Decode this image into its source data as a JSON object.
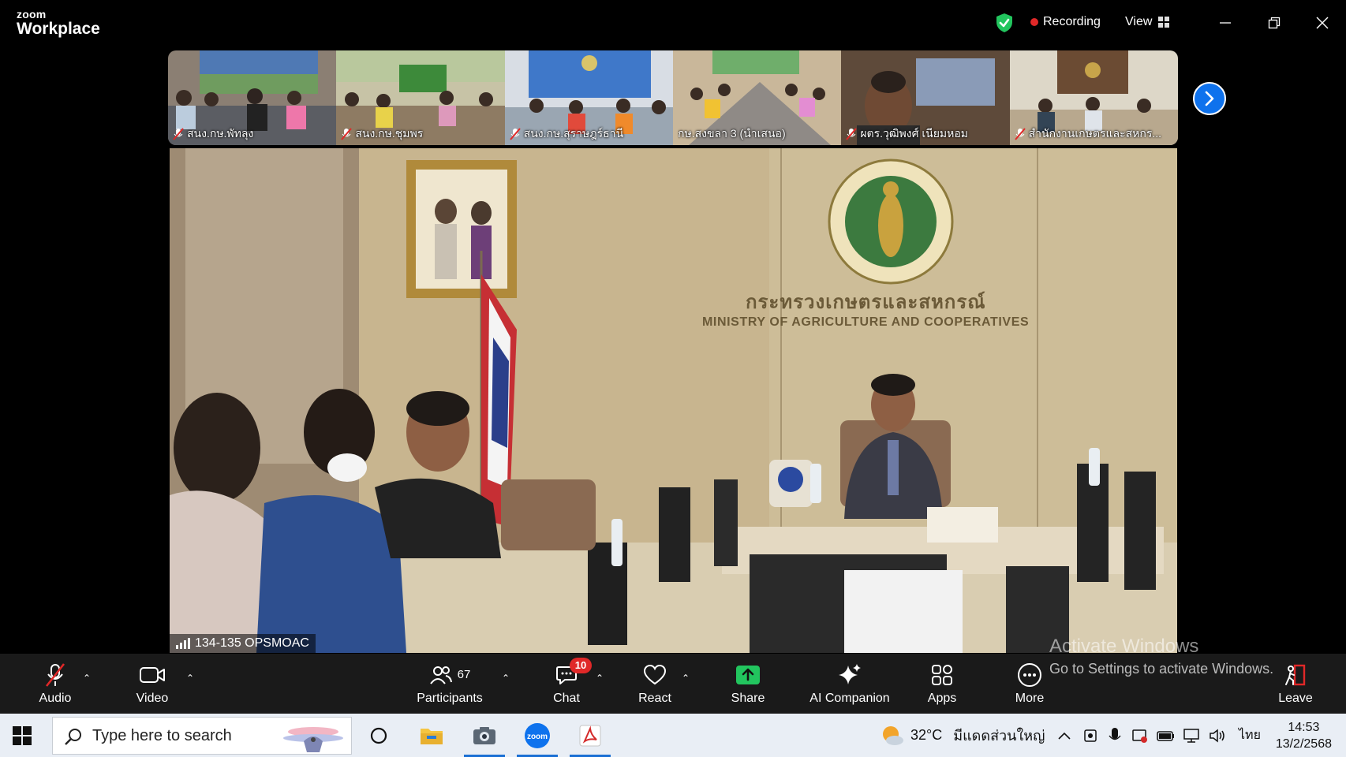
{
  "app": {
    "brand": "zoom",
    "product": "Workplace",
    "recording_label": "Recording",
    "view_label": "View"
  },
  "thumbnails": [
    {
      "name": "สนง.กษ.พัทลุง",
      "muted": true
    },
    {
      "name": "สนง.กษ.ชุมพร",
      "muted": true
    },
    {
      "name": "สนง.กษ.สุราษฎร์ธานี",
      "muted": true
    },
    {
      "name": "กษ.สงขลา 3 (นำเสนอ)",
      "muted": false
    },
    {
      "name": "ผตร.วุฒิพงศ์ เนียมหอม",
      "muted": true
    },
    {
      "name": "สำนักงานเกษตรและสหกร...",
      "muted": true
    }
  ],
  "main_video": {
    "speaker_label": "134-135 OPSMOAC",
    "sign_thai": "กระทรวงเกษตรและสหกรณ์",
    "sign_english": "MINISTRY OF AGRICULTURE AND COOPERATIVES"
  },
  "watermark": {
    "title": "Activate Windows",
    "subtitle": "Go to Settings to activate Windows."
  },
  "toolbar": {
    "audio": "Audio",
    "video": "Video",
    "participants": "Participants",
    "participants_count": "67",
    "chat": "Chat",
    "chat_badge": "10",
    "react": "React",
    "share": "Share",
    "ai_companion": "AI Companion",
    "apps": "Apps",
    "more": "More",
    "leave": "Leave"
  },
  "taskbar": {
    "search_placeholder": "Type here to search",
    "weather_temp": "32°C",
    "weather_desc": "มีแดดส่วนใหญ่",
    "language": "ไทย",
    "time": "14:53",
    "date": "13/2/2568"
  },
  "colors": {
    "accent_blue": "#0e72ed",
    "share_green": "#22c55e",
    "recording_red": "#e02828",
    "leave_red": "#e02828"
  }
}
